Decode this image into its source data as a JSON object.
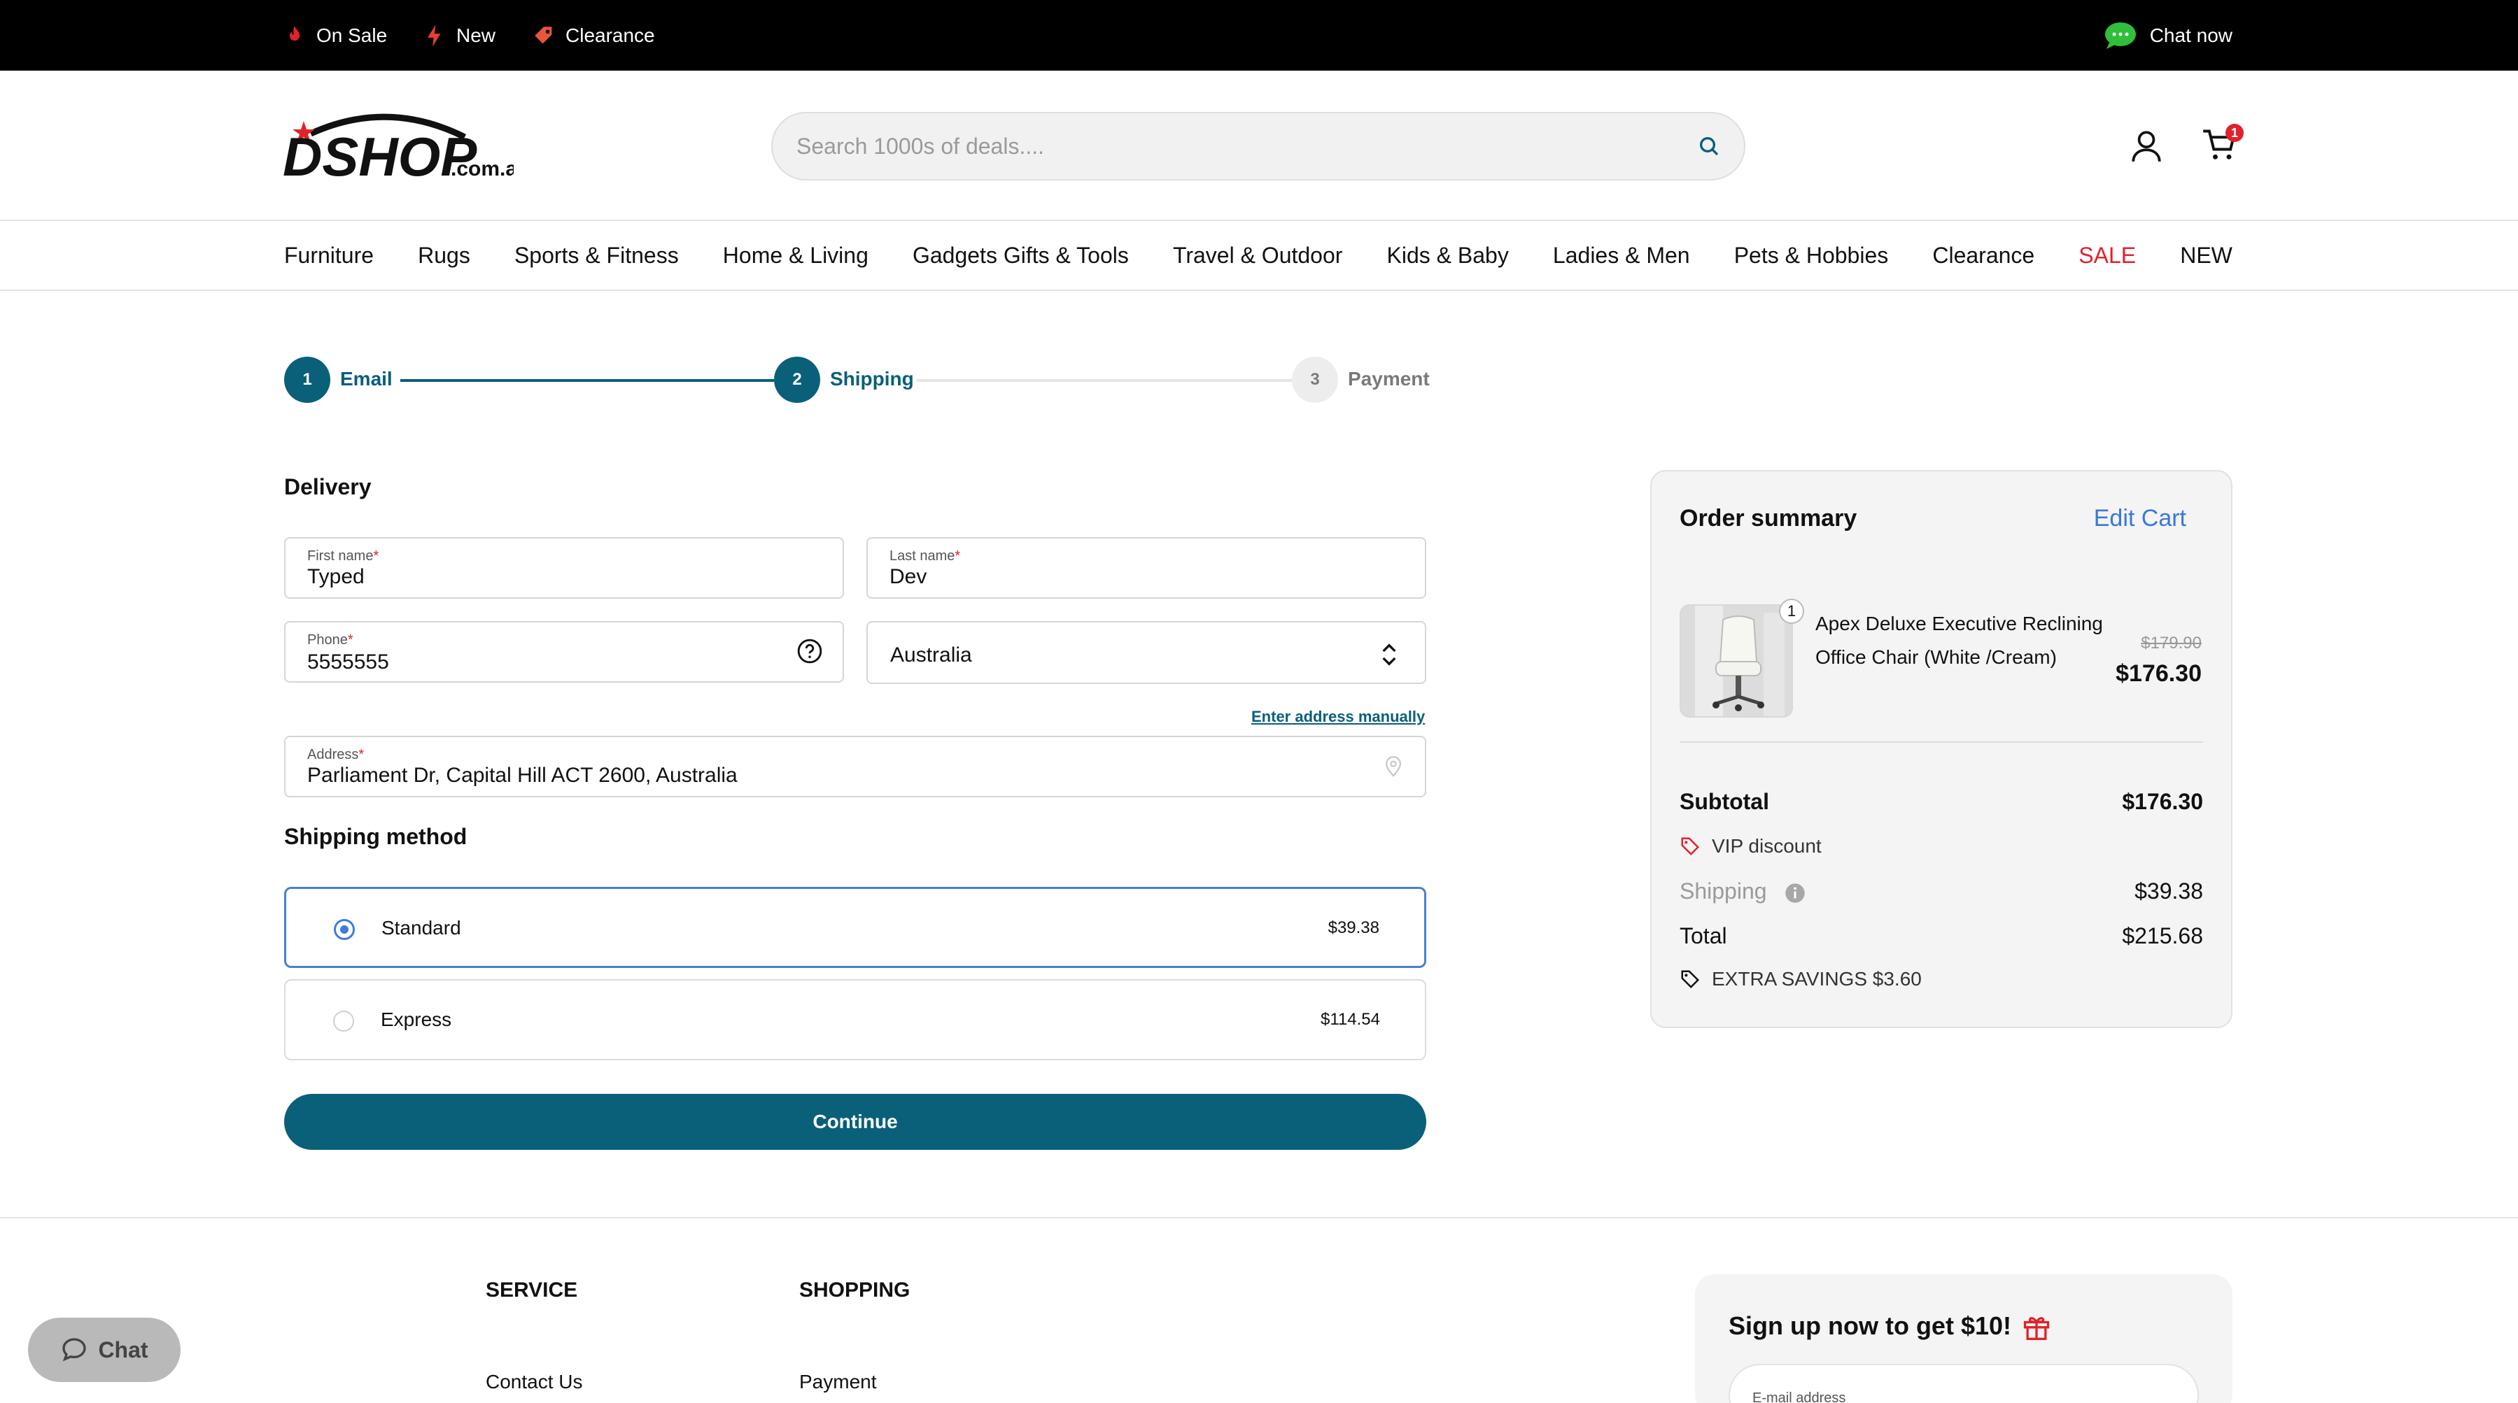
{
  "topbar": {
    "promos": [
      {
        "label": "On Sale",
        "icon": "fire-icon"
      },
      {
        "label": "New",
        "icon": "lightning-icon"
      },
      {
        "label": "Clearance",
        "icon": "tag-icon"
      }
    ],
    "chat_label": "Chat now",
    "chat_icon": "chat-bubble-icon"
  },
  "header": {
    "logo_text": "DSHOP",
    "logo_suffix": ".com.au",
    "search_placeholder": "Search 1000s of deals....",
    "cart_count": "1"
  },
  "nav": {
    "items": [
      "Furniture",
      "Rugs",
      "Sports & Fitness",
      "Home & Living",
      "Gadgets Gifts & Tools",
      "Travel & Outdoor",
      "Kids & Baby",
      "Ladies & Men",
      "Pets & Hobbies",
      "Clearance",
      "SALE",
      "NEW"
    ]
  },
  "stepper": {
    "steps": [
      {
        "num": "1",
        "label": "Email"
      },
      {
        "num": "2",
        "label": "Shipping"
      },
      {
        "num": "3",
        "label": "Payment"
      }
    ]
  },
  "delivery": {
    "title": "Delivery",
    "first_name": {
      "label": "First name",
      "required": "*",
      "value": "Typed"
    },
    "last_name": {
      "label": "Last name",
      "required": "*",
      "value": "Dev"
    },
    "phone": {
      "label": "Phone",
      "required": "*",
      "value": "5555555"
    },
    "country": "Australia",
    "manual_link": "Enter address manually",
    "address": {
      "label": "Address",
      "required": "*",
      "value": "Parliament Dr, Capital Hill ACT 2600, Australia"
    }
  },
  "shipping": {
    "title": "Shipping method",
    "options": [
      {
        "name": "Standard",
        "price": "$39.38",
        "selected": true
      },
      {
        "name": "Express",
        "price": "$114.54",
        "selected": false
      }
    ]
  },
  "continue_label": "Continue",
  "summary": {
    "title": "Order summary",
    "edit_label": "Edit Cart",
    "item": {
      "qty": "1",
      "name": "Apex Deluxe Executive Reclining Office Chair (White /Cream)",
      "old_price": "$179.90",
      "price": "$176.30"
    },
    "subtotal_label": "Subtotal",
    "subtotal": "$176.30",
    "vip_label": "VIP discount",
    "shipping_label": "Shipping",
    "shipping": "$39.38",
    "total_label": "Total",
    "total": "$215.68",
    "savings_label": "EXTRA SAVINGS $3.60"
  },
  "footer": {
    "service_title": "SERVICE",
    "shopping_title": "SHOPPING",
    "service_link": "Contact Us",
    "shopping_link": "Payment",
    "signup_title": "Sign up now to get $10!",
    "email_placeholder": "E-mail address"
  },
  "chat_widget_label": "Chat",
  "colors": {
    "brand": "#0a5f79",
    "sale": "#e0222a",
    "link": "#3a78d8",
    "topbar": "#000000"
  }
}
